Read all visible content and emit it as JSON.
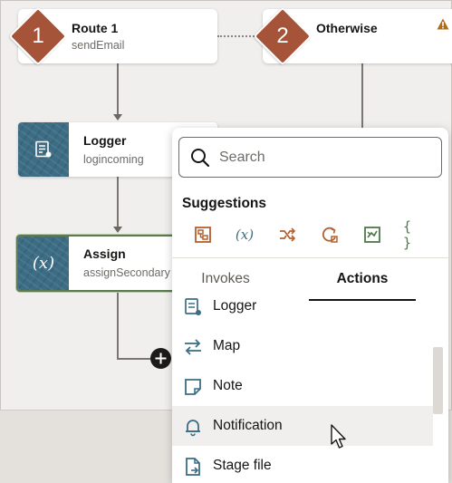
{
  "routes": [
    {
      "number": "1",
      "title": "Route 1",
      "subtitle": "sendEmail"
    },
    {
      "number": "2",
      "title": "Otherwise",
      "subtitle": ""
    }
  ],
  "actions": [
    {
      "title": "Logger",
      "subtitle": "logincoming",
      "icon": "logger-icon"
    },
    {
      "title": "Assign",
      "subtitle": "assignSecondary",
      "icon": "variable-fx-icon",
      "icon_text": "(x)"
    }
  ],
  "panel": {
    "search_placeholder": "Search",
    "suggestions_label": "Suggestions",
    "suggestion_icons": [
      {
        "name": "data-stitch-icon"
      },
      {
        "name": "variable-fx-icon",
        "text": "(x)"
      },
      {
        "name": "switch-icon"
      },
      {
        "name": "for-each-icon"
      },
      {
        "name": "map-icon"
      },
      {
        "name": "json-icon",
        "text": "{ }"
      }
    ],
    "tabs": [
      {
        "label": "Invokes"
      },
      {
        "label": "Actions",
        "active": true
      }
    ],
    "items": [
      {
        "label": "Logger",
        "icon": "logger-icon"
      },
      {
        "label": "Map",
        "icon": "map-arrows-icon"
      },
      {
        "label": "Note",
        "icon": "note-icon"
      },
      {
        "label": "Notification",
        "icon": "bell-icon"
      },
      {
        "label": "Stage file",
        "icon": "stage-file-icon"
      }
    ]
  },
  "colors": {
    "diamond": "#a5543a",
    "action_icon_bg": "#3c6d84",
    "suggest_orange": "#b5602e",
    "suggest_teal": "#3c6d84",
    "suggest_green": "#4c7a47",
    "warning": "#b06a14"
  }
}
